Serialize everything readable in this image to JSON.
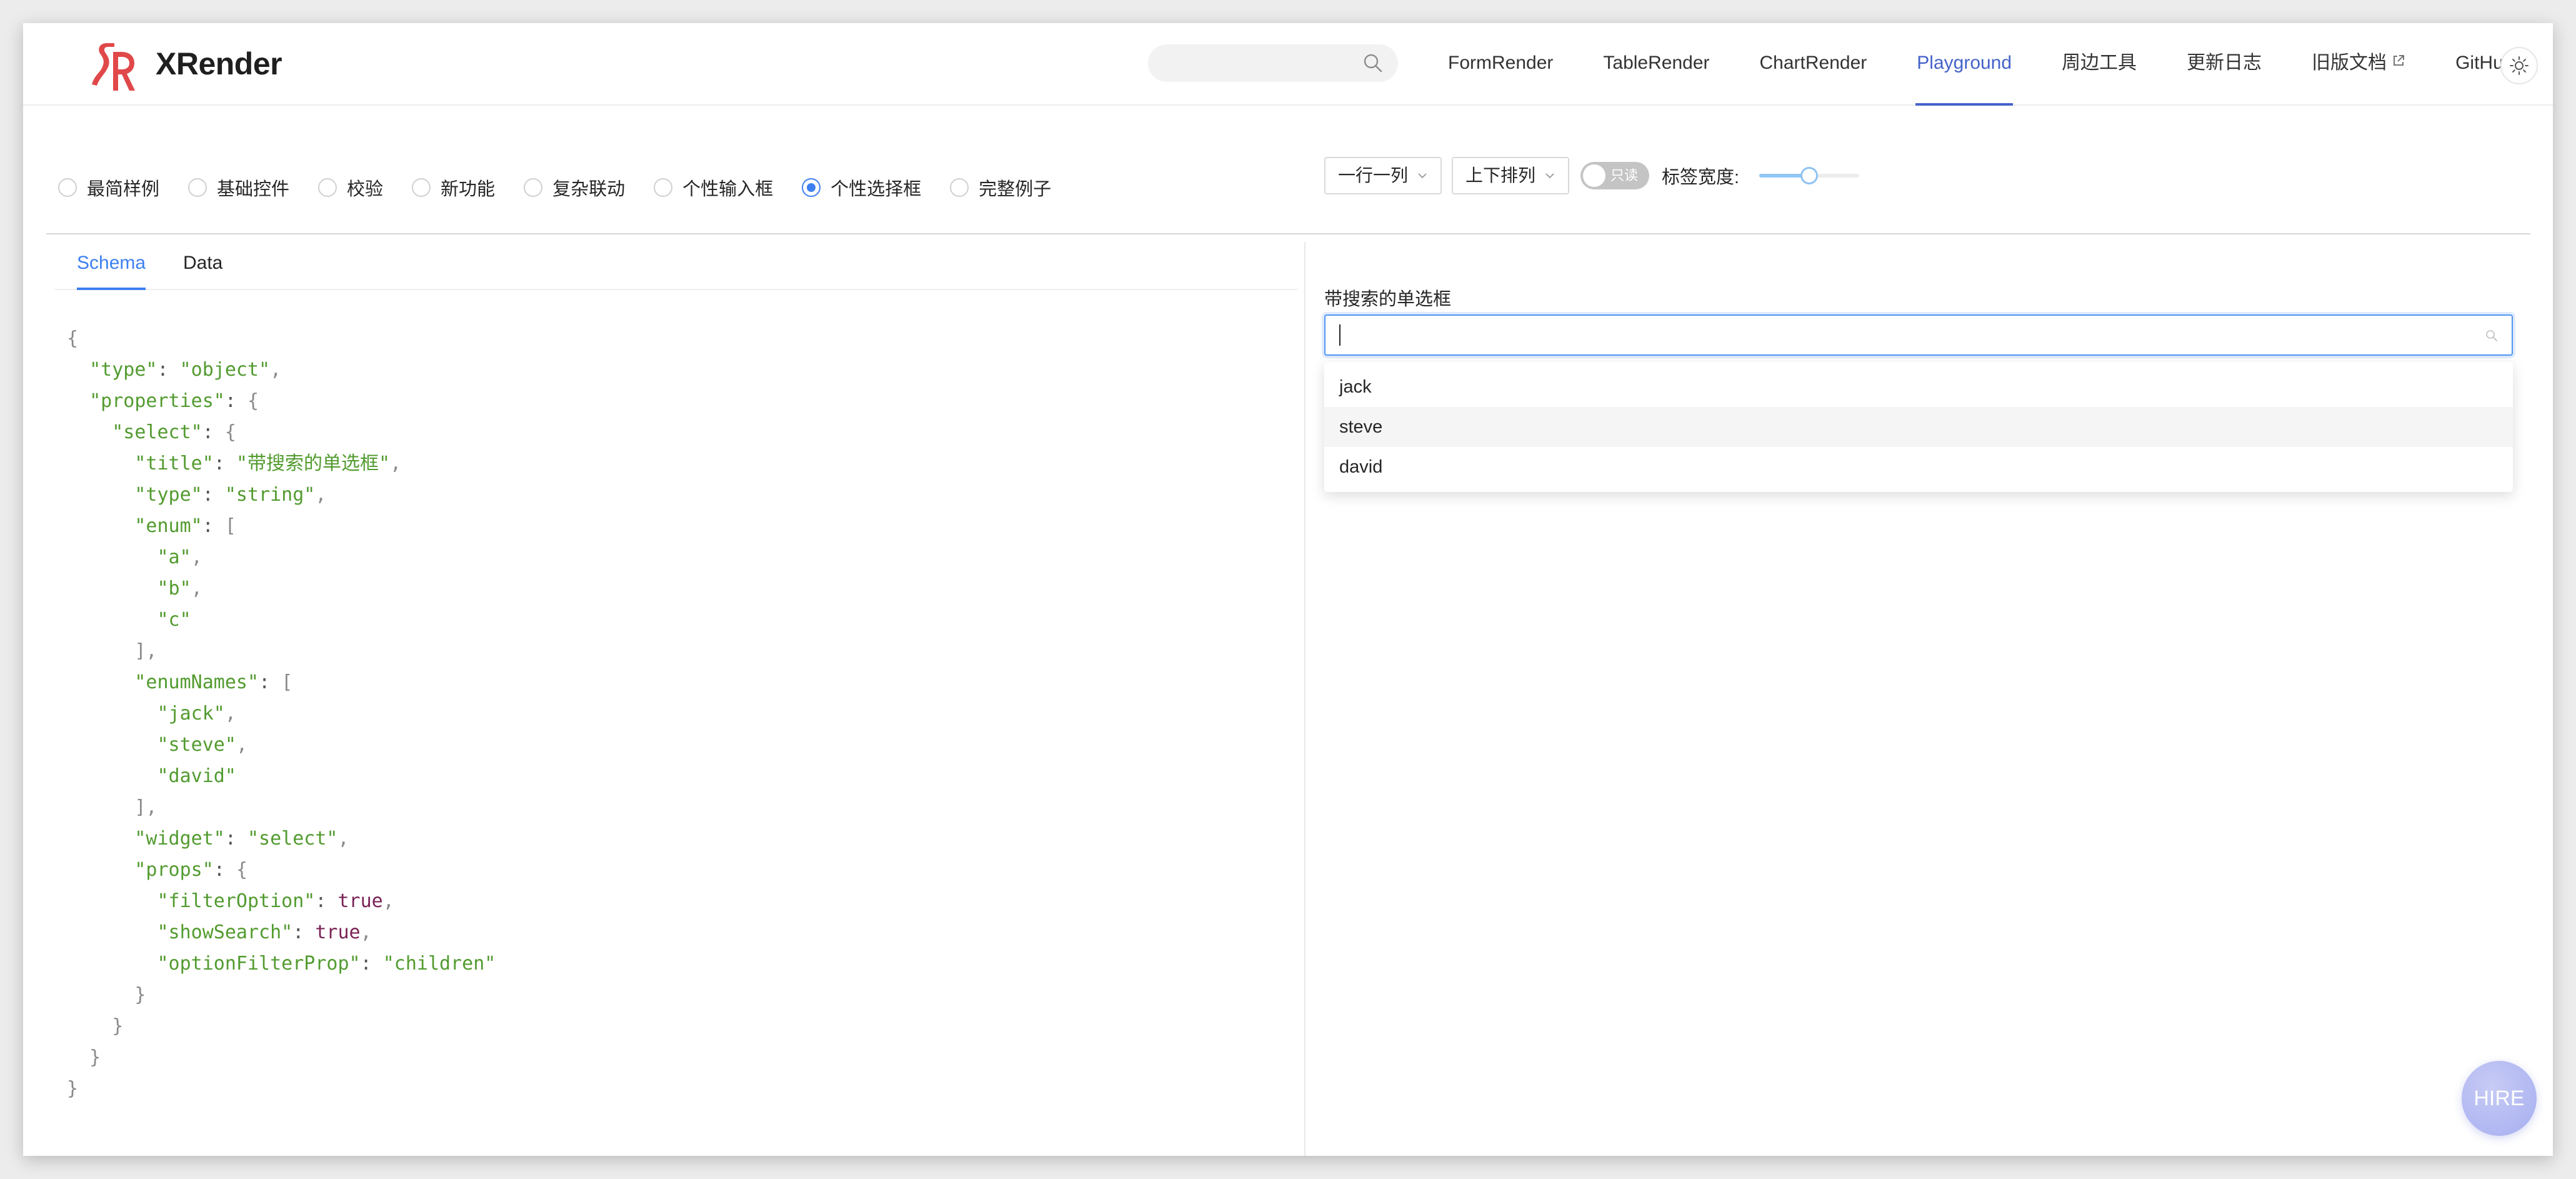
{
  "header": {
    "logo_text": "XRender",
    "search": {
      "value": "",
      "placeholder": ""
    },
    "nav": [
      {
        "label": "FormRender",
        "active": false,
        "external": false
      },
      {
        "label": "TableRender",
        "active": false,
        "external": false
      },
      {
        "label": "ChartRender",
        "active": false,
        "external": false
      },
      {
        "label": "Playground",
        "active": true,
        "external": false
      },
      {
        "label": "周边工具",
        "active": false,
        "external": false
      },
      {
        "label": "更新日志",
        "active": false,
        "external": false
      },
      {
        "label": "旧版文档",
        "active": false,
        "external": true
      },
      {
        "label": "GitHub",
        "active": false,
        "external": true
      }
    ],
    "accent_color": "#4462c9"
  },
  "examples": {
    "options": [
      "最简样例",
      "基础控件",
      "校验",
      "新功能",
      "复杂联动",
      "个性输入框",
      "个性选择框",
      "完整例子"
    ],
    "selected": "个性选择框"
  },
  "toolbar": {
    "columns_select": "一行一列",
    "layout_select": "上下排列",
    "readonly_label": "只读",
    "readonly_on": false,
    "label_width_label": "标签宽度:",
    "label_width_fraction": 0.5
  },
  "tabs": [
    {
      "label": "Schema",
      "active": true
    },
    {
      "label": "Data",
      "active": false
    }
  ],
  "schema_lines": [
    [
      {
        "t": "{",
        "c": "p"
      }
    ],
    [
      {
        "t": "  "
      },
      {
        "t": "\"type\"",
        "c": "k"
      },
      {
        "t": ": "
      },
      {
        "t": "\"object\"",
        "c": "s"
      },
      {
        "t": ",",
        "c": "p"
      }
    ],
    [
      {
        "t": "  "
      },
      {
        "t": "\"properties\"",
        "c": "k"
      },
      {
        "t": ": "
      },
      {
        "t": "{",
        "c": "p"
      }
    ],
    [
      {
        "t": "    "
      },
      {
        "t": "\"select\"",
        "c": "k"
      },
      {
        "t": ": "
      },
      {
        "t": "{",
        "c": "p"
      }
    ],
    [
      {
        "t": "      "
      },
      {
        "t": "\"title\"",
        "c": "k"
      },
      {
        "t": ": "
      },
      {
        "t": "\"带搜索的单选框\"",
        "c": "s"
      },
      {
        "t": ",",
        "c": "p"
      }
    ],
    [
      {
        "t": "      "
      },
      {
        "t": "\"type\"",
        "c": "k"
      },
      {
        "t": ": "
      },
      {
        "t": "\"string\"",
        "c": "s"
      },
      {
        "t": ",",
        "c": "p"
      }
    ],
    [
      {
        "t": "      "
      },
      {
        "t": "\"enum\"",
        "c": "k"
      },
      {
        "t": ": "
      },
      {
        "t": "[",
        "c": "p"
      }
    ],
    [
      {
        "t": "        "
      },
      {
        "t": "\"a\"",
        "c": "s"
      },
      {
        "t": ",",
        "c": "p"
      }
    ],
    [
      {
        "t": "        "
      },
      {
        "t": "\"b\"",
        "c": "s"
      },
      {
        "t": ",",
        "c": "p"
      }
    ],
    [
      {
        "t": "        "
      },
      {
        "t": "\"c\"",
        "c": "s"
      }
    ],
    [
      {
        "t": "      "
      },
      {
        "t": "],",
        "c": "p"
      }
    ],
    [
      {
        "t": "      "
      },
      {
        "t": "\"enumNames\"",
        "c": "k"
      },
      {
        "t": ": "
      },
      {
        "t": "[",
        "c": "p"
      }
    ],
    [
      {
        "t": "        "
      },
      {
        "t": "\"jack\"",
        "c": "s"
      },
      {
        "t": ",",
        "c": "p"
      }
    ],
    [
      {
        "t": "        "
      },
      {
        "t": "\"steve\"",
        "c": "s"
      },
      {
        "t": ",",
        "c": "p"
      }
    ],
    [
      {
        "t": "        "
      },
      {
        "t": "\"david\"",
        "c": "s"
      }
    ],
    [
      {
        "t": "      "
      },
      {
        "t": "],",
        "c": "p"
      }
    ],
    [
      {
        "t": "      "
      },
      {
        "t": "\"widget\"",
        "c": "k"
      },
      {
        "t": ": "
      },
      {
        "t": "\"select\"",
        "c": "s"
      },
      {
        "t": ",",
        "c": "p"
      }
    ],
    [
      {
        "t": "      "
      },
      {
        "t": "\"props\"",
        "c": "k"
      },
      {
        "t": ": "
      },
      {
        "t": "{",
        "c": "p"
      }
    ],
    [
      {
        "t": "        "
      },
      {
        "t": "\"filterOption\"",
        "c": "k"
      },
      {
        "t": ": "
      },
      {
        "t": "true",
        "c": "b"
      },
      {
        "t": ",",
        "c": "p"
      }
    ],
    [
      {
        "t": "        "
      },
      {
        "t": "\"showSearch\"",
        "c": "k"
      },
      {
        "t": ": "
      },
      {
        "t": "true",
        "c": "b"
      },
      {
        "t": ",",
        "c": "p"
      }
    ],
    [
      {
        "t": "        "
      },
      {
        "t": "\"optionFilterProp\"",
        "c": "k"
      },
      {
        "t": ": "
      },
      {
        "t": "\"children\"",
        "c": "s"
      }
    ],
    [
      {
        "t": "      "
      },
      {
        "t": "}",
        "c": "p"
      }
    ],
    [
      {
        "t": "    "
      },
      {
        "t": "}",
        "c": "p"
      }
    ],
    [
      {
        "t": "  "
      },
      {
        "t": "}",
        "c": "p"
      }
    ],
    [
      {
        "t": "}",
        "c": "p"
      }
    ]
  ],
  "form": {
    "field_label": "带搜索的单选框",
    "input_value": "",
    "dropdown_options": [
      "jack",
      "steve",
      "david"
    ],
    "hovered_option": "steve"
  },
  "hire_label": "HIRE"
}
